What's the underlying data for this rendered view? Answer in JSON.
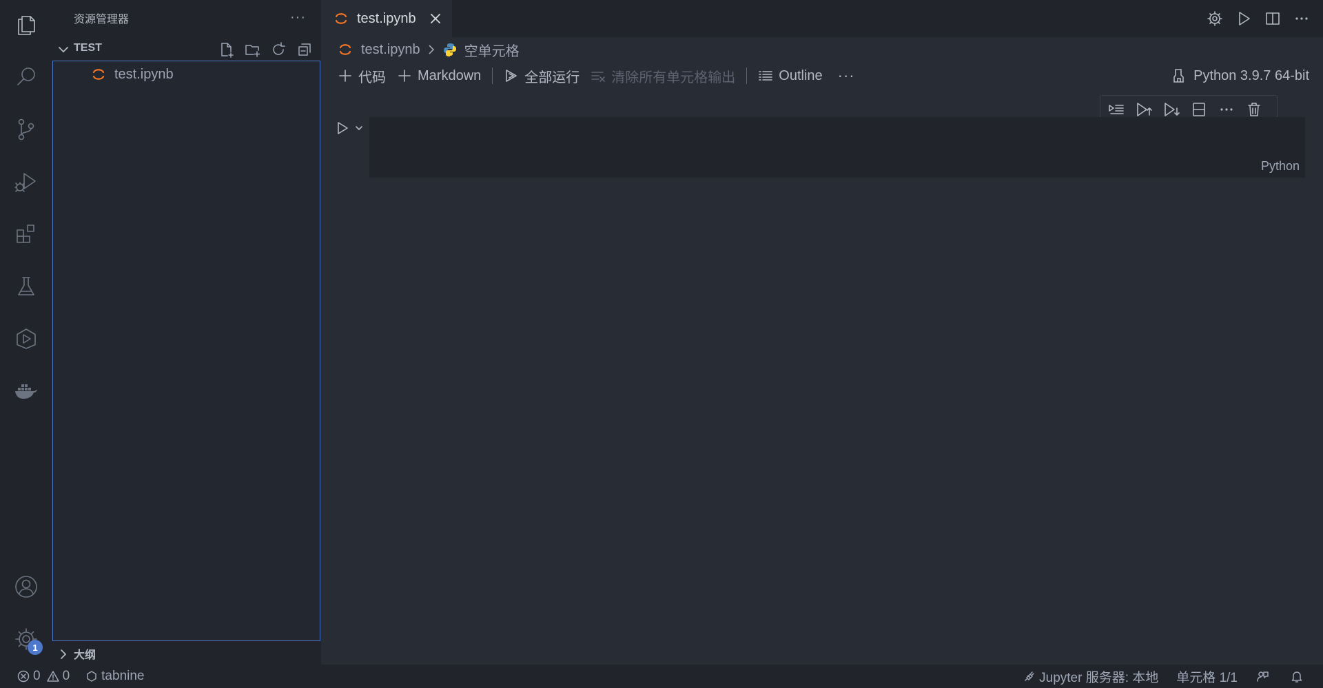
{
  "activity_bar": {
    "icons": [
      "explorer-icon",
      "search-icon",
      "source-control-icon",
      "run-debug-icon",
      "extensions-icon",
      "testing-icon",
      "remote-explorer-icon",
      "docker-icon"
    ],
    "bottom_icons": [
      "accounts-icon",
      "manage-gear-icon"
    ],
    "settings_badge": "1"
  },
  "sidebar": {
    "title": "资源管理器",
    "more": "···",
    "folder": "TEST",
    "files": [
      {
        "name": "test.ipynb",
        "icon": "jupyter-icon"
      }
    ],
    "outline_label": "大纲"
  },
  "tab": {
    "label": "test.ipynb"
  },
  "breadcrumb": {
    "file": "test.ipynb",
    "cell": "空单元格"
  },
  "notebook_toolbar": {
    "add_code": "代码",
    "add_markdown": "Markdown",
    "run_all": "全部运行",
    "clear_outputs": "清除所有单元格输出",
    "outline": "Outline",
    "more": "···"
  },
  "kernel": {
    "label": "Python 3.9.7 64-bit"
  },
  "cell": {
    "language": "Python"
  },
  "statusbar": {
    "errors": "0",
    "warnings": "0",
    "tabnine": "tabnine",
    "jupyter_server": "Jupyter 服务器: 本地",
    "cell_position": "单元格 1/1"
  },
  "colors": {
    "accent": "#4d78cc",
    "background": "#282c34",
    "panel": "#21252b",
    "jupyter_orange": "#f37726"
  }
}
